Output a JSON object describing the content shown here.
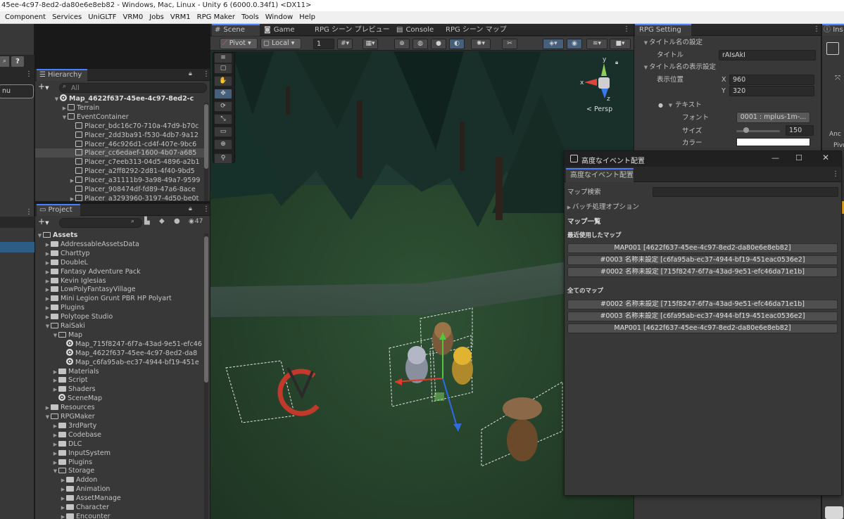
{
  "window_title": "45ee-4c97-8ed2-da80e6e8eb82 - Windows, Mac, Linux - Unity 6 (6000.0.34f1) <DX11>",
  "menu": [
    "Component",
    "Services",
    "UniGLTF",
    "VRM0",
    "Jobs",
    "VRM1",
    "RPG Maker",
    "Tools",
    "Window",
    "Help"
  ],
  "left_stub": {
    "field_text": "nu",
    "help_glyph": "?"
  },
  "hierarchy": {
    "tab": "Hierarchy",
    "search_placeholder": "All",
    "add_glyph": "+",
    "rows": [
      {
        "label": "Map_4622f637-45ee-4c97-8ed2-c",
        "indent": 0,
        "icon": "scene",
        "expand": "▼",
        "bold": true
      },
      {
        "label": "Terrain",
        "indent": 1,
        "icon": "cube",
        "expand": "▶"
      },
      {
        "label": "EventContainer",
        "indent": 1,
        "icon": "cube",
        "expand": "▼"
      },
      {
        "label": "Placer_bdc16c70-710a-47d9-b70c",
        "indent": 2,
        "icon": "cube",
        "expand": ""
      },
      {
        "label": "Placer_2dd3ba91-f530-4db7-9a12",
        "indent": 2,
        "icon": "cube",
        "expand": ""
      },
      {
        "label": "Placer_46c926d1-cd4f-407e-9bc6",
        "indent": 2,
        "icon": "cube",
        "expand": ""
      },
      {
        "label": "Placer_cc6edaef-1600-4b07-a685",
        "indent": 2,
        "icon": "cube",
        "expand": "",
        "selected": true
      },
      {
        "label": "Placer_c7eeb313-04d5-4896-a2b1",
        "indent": 2,
        "icon": "cube",
        "expand": ""
      },
      {
        "label": "Placer_a2ff8292-2d81-4f40-9bd5",
        "indent": 2,
        "icon": "cube",
        "expand": ""
      },
      {
        "label": "Placer_a31111b9-3a98-49a7-9599",
        "indent": 2,
        "icon": "cube",
        "expand": "▶"
      },
      {
        "label": "Placer_908474df-fd89-47a6-8ace",
        "indent": 2,
        "icon": "cube",
        "expand": ""
      },
      {
        "label": "Placer_a3293960-3197-4d50-be0t",
        "indent": 2,
        "icon": "cube",
        "expand": "▶"
      }
    ]
  },
  "project": {
    "tab": "Project",
    "add_glyph": "+",
    "count": "47",
    "rows": [
      {
        "label": "Assets",
        "indent": 0,
        "icon": "folder-open",
        "expand": "▼",
        "bold": true
      },
      {
        "label": "AddressableAssetsData",
        "indent": 1,
        "icon": "folder",
        "expand": "▶"
      },
      {
        "label": "Charttyp",
        "indent": 1,
        "icon": "folder",
        "expand": "▶"
      },
      {
        "label": "DoubleL",
        "indent": 1,
        "icon": "folder",
        "expand": "▶"
      },
      {
        "label": "Fantasy Adventure Pack",
        "indent": 1,
        "icon": "folder",
        "expand": "▶"
      },
      {
        "label": "Kevin Iglesias",
        "indent": 1,
        "icon": "folder",
        "expand": "▶"
      },
      {
        "label": "LowPolyFantasyVillage",
        "indent": 1,
        "icon": "folder",
        "expand": "▶"
      },
      {
        "label": "Mini Legion Grunt PBR HP Polyart",
        "indent": 1,
        "icon": "folder",
        "expand": "▶"
      },
      {
        "label": "Plugins",
        "indent": 1,
        "icon": "folder",
        "expand": "▶"
      },
      {
        "label": "Polytope Studio",
        "indent": 1,
        "icon": "folder",
        "expand": "▶"
      },
      {
        "label": "RaiSaki",
        "indent": 1,
        "icon": "folder-open",
        "expand": "▼"
      },
      {
        "label": "Map",
        "indent": 2,
        "icon": "folder-open",
        "expand": "▼"
      },
      {
        "label": "Map_715f8247-6f7a-43ad-9e51-efc46",
        "indent": 3,
        "icon": "scene",
        "expand": ""
      },
      {
        "label": "Map_4622f637-45ee-4c97-8ed2-da8",
        "indent": 3,
        "icon": "scene",
        "expand": ""
      },
      {
        "label": "Map_c6fa95ab-ec37-4944-bf19-451e",
        "indent": 3,
        "icon": "scene",
        "expand": ""
      },
      {
        "label": "Materials",
        "indent": 2,
        "icon": "folder",
        "expand": "▶"
      },
      {
        "label": "Script",
        "indent": 2,
        "icon": "folder",
        "expand": "▶"
      },
      {
        "label": "Shaders",
        "indent": 2,
        "icon": "folder",
        "expand": "▶"
      },
      {
        "label": "SceneMap",
        "indent": 2,
        "icon": "scene",
        "expand": ""
      },
      {
        "label": "Resources",
        "indent": 1,
        "icon": "folder",
        "expand": "▶"
      },
      {
        "label": "RPGMaker",
        "indent": 1,
        "icon": "folder-open",
        "expand": "▼"
      },
      {
        "label": "3rdParty",
        "indent": 2,
        "icon": "folder",
        "expand": "▶"
      },
      {
        "label": "Codebase",
        "indent": 2,
        "icon": "folder",
        "expand": "▶"
      },
      {
        "label": "DLC",
        "indent": 2,
        "icon": "folder",
        "expand": "▶"
      },
      {
        "label": "InputSystem",
        "indent": 2,
        "icon": "folder",
        "expand": "▶"
      },
      {
        "label": "Plugins",
        "indent": 2,
        "icon": "folder",
        "expand": "▶"
      },
      {
        "label": "Storage",
        "indent": 2,
        "icon": "folder-open",
        "expand": "▼"
      },
      {
        "label": "Addon",
        "indent": 3,
        "icon": "folder",
        "expand": "▶"
      },
      {
        "label": "Animation",
        "indent": 3,
        "icon": "folder",
        "expand": "▶"
      },
      {
        "label": "AssetManage",
        "indent": 3,
        "icon": "folder",
        "expand": "▶"
      },
      {
        "label": "Character",
        "indent": 3,
        "icon": "folder",
        "expand": "▶"
      },
      {
        "label": "Encounter",
        "indent": 3,
        "icon": "folder",
        "expand": "▶"
      }
    ]
  },
  "scene_tabs": [
    {
      "label": "Scene",
      "icon": "#",
      "active": true
    },
    {
      "label": "Game",
      "icon": "◙",
      "active": false
    },
    {
      "label": "RPG シーン プレビュー",
      "icon": "",
      "active": false
    },
    {
      "label": "Console",
      "icon": "▤",
      "active": false
    },
    {
      "label": "RPG シーン マップ",
      "icon": "",
      "active": false
    }
  ],
  "scene_toolbar": {
    "pivot": "Pivot",
    "local": "Local",
    "snap_value": "1"
  },
  "scene_tools": [
    "≡",
    "▢",
    "✋",
    "✥",
    "⟳",
    "⤡",
    "▭",
    "⊕",
    "⚲"
  ],
  "scene_gizmo": {
    "persp_label": "< Persp",
    "x": "x",
    "y": "y",
    "z": "z"
  },
  "rpg_setting": {
    "tab": "RPG Setting",
    "section_title_name": "タイトル名の設定",
    "title_label": "タイトル",
    "title_value": "rAIsAkI",
    "section_display": "タイトル名の表示設定",
    "pos_label": "表示位置",
    "x_label": "X",
    "x_value": "960",
    "y_label": "Y",
    "y_value": "320",
    "text_label": "テキスト",
    "font_label": "フォント",
    "font_value": "0001 : mplus-1m-...",
    "size_label": "サイズ",
    "size_value": "150",
    "size_slider": 0.1,
    "color_label": "カラー",
    "color_value": "#ffffff"
  },
  "event_window": {
    "title": "高度なイベント配置",
    "tab": "高度なイベント配置",
    "search_label": "マップ検索",
    "batch_label": "バッチ処理オプション",
    "list_header": "マップ一覧",
    "recent_header": "最近使用したマップ",
    "recent": [
      "MAP001 [4622f637-45ee-4c97-8ed2-da80e6e8eb82]",
      "#0003 名称未設定 [c6fa95ab-ec37-4944-bf19-451eac0536e2]",
      "#0002 名称未設定 [715f8247-6f7a-43ad-9e51-efc46da71e1b]"
    ],
    "all_header": "全てのマップ",
    "all": [
      "#0002 名称未設定 [715f8247-6f7a-43ad-9e51-efc46da71e1b]",
      "#0003 名称未設定 [c6fa95ab-ec37-4944-bf19-451eac0536e2]",
      "MAP001 [4622f637-45ee-4c97-8ed2-da80e6e8eb82]"
    ]
  },
  "inspector": {
    "tab": "Ins",
    "labels": [
      "Anc",
      "Pivo"
    ]
  },
  "colors": {
    "accent": "#4c7eff",
    "panel": "#383838",
    "selection": "#2c5d87",
    "grass": "#2b4a2f"
  }
}
